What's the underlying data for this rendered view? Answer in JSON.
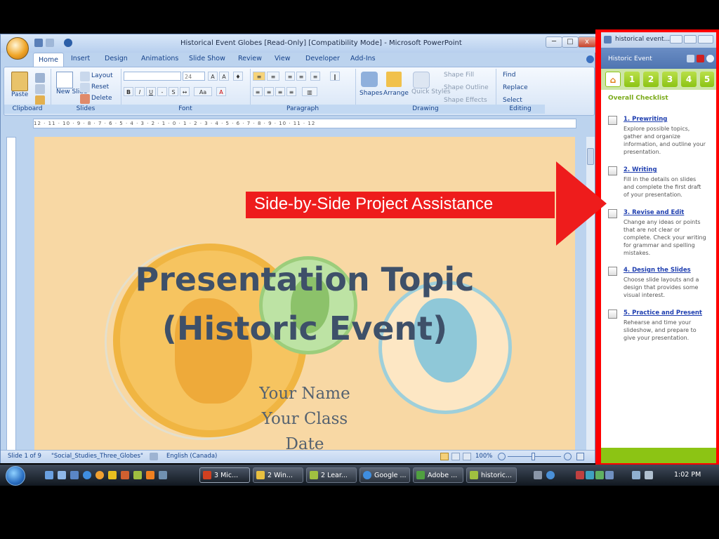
{
  "window": {
    "title": "Historical Event Globes [Read-Only] [Compatibility Mode] - Microsoft PowerPoint",
    "controls": {
      "minimize": "─",
      "maximize": "□",
      "close": "x"
    }
  },
  "ribbon": {
    "tabs": [
      "Home",
      "Insert",
      "Design",
      "Animations",
      "Slide Show",
      "Review",
      "View",
      "Developer",
      "Add-Ins"
    ],
    "clipboard": {
      "paste": "Paste",
      "label": "Clipboard"
    },
    "slides": {
      "new_slide": "New Slide",
      "layout": "Layout",
      "reset": "Reset",
      "delete": "Delete",
      "label": "Slides"
    },
    "font": {
      "size": "24",
      "label": "Font"
    },
    "paragraph": {
      "label": "Paragraph"
    },
    "drawing": {
      "shapes": "Shapes",
      "arrange": "Arrange",
      "quick_styles": "Quick Styles",
      "shape_fill": "Shape Fill",
      "shape_outline": "Shape Outline",
      "shape_effects": "Shape Effects",
      "label": "Drawing"
    },
    "editing": {
      "find": "Find",
      "replace": "Replace",
      "select": "Select",
      "label": "Editing"
    }
  },
  "ruler": {
    "text": "12 · 11 · 10 · 9 · 8 · 7 · 6 · 5 · 4 · 3 · 2 · 1 · 0 · 1 · 2 · 3 · 4 · 5 · 6 · 7 · 8 · 9 · 10 · 11 · 12"
  },
  "slide": {
    "title_line1": "Presentation Topic",
    "title_line2": "(Historic Event)",
    "sub_name": "Your Name",
    "sub_class": "Your Class",
    "sub_date": "Date"
  },
  "callout": {
    "text": "Side-by-Side Project Assistance"
  },
  "status": {
    "slide": "Slide 1 of 9",
    "theme": "\"Social_Studies_Three_Globes\"",
    "language": "English (Canada)",
    "zoom": "100%"
  },
  "pane": {
    "window_title": "historical event...",
    "header": "Historic Event",
    "tabs": [
      "1",
      "2",
      "3",
      "4",
      "5"
    ],
    "checklist_title": "Overall Checklist",
    "items": [
      {
        "title": "1. Prewriting",
        "desc": "Explore possible topics, gather and organize information, and outline your presentation."
      },
      {
        "title": "2. Writing",
        "desc": "Fill in the details on slides and complete the first draft of your presentation."
      },
      {
        "title": "3. Revise and Edit",
        "desc": "Change any ideas or points that are not clear or complete. Check your writing for grammar and spelling mistakes."
      },
      {
        "title": "4. Design the Slides",
        "desc": "Choose slide layouts and a design that provides some visual interest."
      },
      {
        "title": "5. Practice and Present",
        "desc": "Rehearse and time your slideshow, and prepare to give your presentation."
      }
    ]
  },
  "taskbar": {
    "buttons": [
      "3 Mic...",
      "2 Win...",
      "2 Lear...",
      "Google ...",
      "Adobe ...",
      "historic..."
    ],
    "clock": "1:02 PM"
  },
  "colors": {
    "callout": "#ee1c1c",
    "pane_accent": "#8cc414",
    "title_text": "#3e5069"
  }
}
